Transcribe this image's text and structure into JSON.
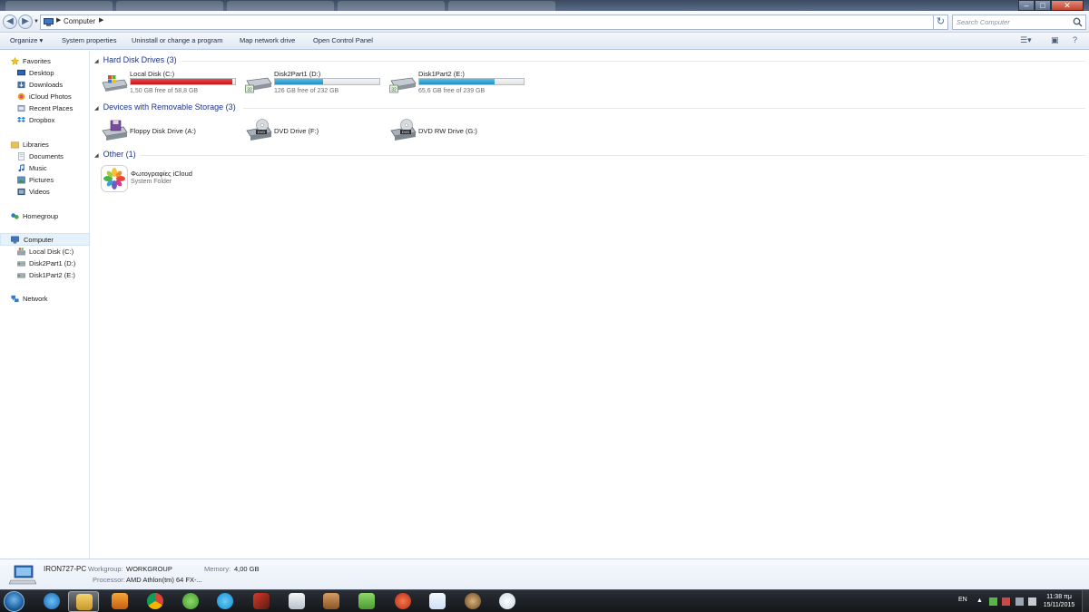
{
  "window": {
    "address": "Computer",
    "search_placeholder": "Search Computer",
    "buttons": {
      "minimize": "‒",
      "maximize": "□",
      "close": "✕"
    }
  },
  "toolbar": {
    "organize": "Organize ▾",
    "system_properties": "System properties",
    "uninstall": "Uninstall or change a program",
    "map_drive": "Map network drive",
    "control_panel": "Open Control Panel"
  },
  "nav": {
    "favorites": "Favorites",
    "desktop": "Desktop",
    "downloads": "Downloads",
    "icloud_photos": "iCloud Photos",
    "recent_places": "Recent Places",
    "dropbox": "Dropbox",
    "libraries": "Libraries",
    "documents": "Documents",
    "music": "Music",
    "pictures": "Pictures",
    "videos": "Videos",
    "homegroup": "Homegroup",
    "computer": "Computer",
    "drive_c": "Local Disk (C:)",
    "drive_d": "Disk2Part1 (D:)",
    "drive_e": "Disk1Part2 (E:)",
    "network": "Network"
  },
  "groups": {
    "hdd": "Hard Disk Drives (3)",
    "removable": "Devices with Removable Storage (3)",
    "other": "Other (1)"
  },
  "drives": [
    {
      "name": "Local Disk (C:)",
      "free": "1,50 GB free of 58,8 GB",
      "used_fraction": 0.974,
      "bar_color": "red"
    },
    {
      "name": "Disk2Part1 (D:)",
      "free": "126 GB free of 232 GB",
      "used_fraction": 0.457,
      "bar_color": "blue"
    },
    {
      "name": "Disk1Part2 (E:)",
      "free": "65,6 GB free of 239 GB",
      "used_fraction": 0.725,
      "bar_color": "blue"
    }
  ],
  "removable": [
    {
      "name": "Floppy Disk Drive (A:)"
    },
    {
      "name": "DVD Drive (F:)"
    },
    {
      "name": "DVD RW Drive (G:)"
    }
  ],
  "other_items": [
    {
      "name": "Φωτογραφίες iCloud",
      "sub": "System Folder"
    }
  ],
  "details": {
    "pc_name": "IRON727-PC",
    "workgroup_label": "Workgroup:",
    "workgroup": "WORKGROUP",
    "memory_label": "Memory:",
    "memory": "4,00 GB",
    "processor_label": "Processor:",
    "processor": "AMD Athlon(tm) 64 FX-..."
  },
  "taskbar": {
    "apps": [
      "windows-explorer-ie",
      "internet-explorer",
      "file-explorer",
      "media-player",
      "chrome",
      "utorrent",
      "skype",
      "game-app",
      "icloud",
      "app-brown",
      "evernote",
      "ccleaner",
      "dropbox",
      "app-hat",
      "itunes"
    ],
    "lang": "EN",
    "time": "11:38 πμ",
    "date": "15/11/2015"
  },
  "colors": {
    "link_blue": "#1e3287",
    "bar_blue": "#1e8fbe",
    "bar_red": "#c4141b",
    "selection": "#e5f1fb"
  }
}
